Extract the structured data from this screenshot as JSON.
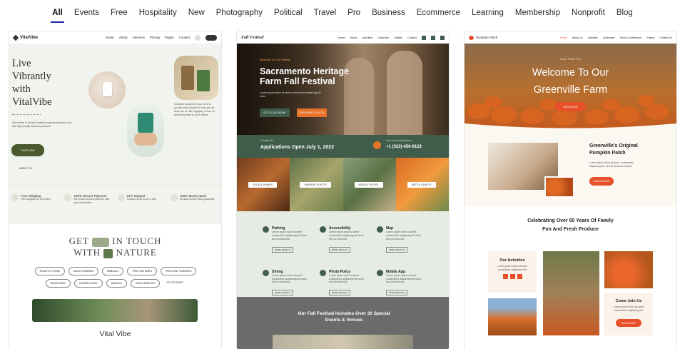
{
  "tabs": [
    "All",
    "Events",
    "Free",
    "Hospitality",
    "New",
    "Photography",
    "Political",
    "Travel",
    "Pro",
    "Business",
    "Ecommerce",
    "Learning",
    "Membership",
    "Nonprofit",
    "Blog"
  ],
  "active_tab": "All",
  "colors": {
    "accent": "#1b2aa8",
    "vital_green": "#4a5a2c",
    "festival_green": "#3f5d4a",
    "farm_orange": "#e8502a"
  },
  "vital": {
    "logo": "VitalVibe",
    "nav": [
      "Home",
      "About",
      "Services",
      "Pricing",
      "Pages",
      "Contact"
    ],
    "headline": [
      "Live",
      "Vibrantly",
      "with",
      "VitalVibe"
    ],
    "intro": "We believe in vibrant, healthy living and empower you with high-quality wellness products.",
    "shop_btn": "SHOP NOW",
    "about_link": "ABOUT US",
    "side_text": "Consider using this if you need to provide more context on why you do what you do. Be engaging. Focus on delivering value to your visitors.",
    "features": [
      {
        "title": "Free Shipping",
        "desc": "Free shipping on all orders"
      },
      {
        "title": "100% Secure Payment",
        "desc": "We ensure secure payment with your information"
      },
      {
        "title": "24/7 Support",
        "desc": "Contact us 24 hours a day"
      },
      {
        "title": "100% Money Back",
        "desc": "30 days money back guarantee"
      }
    ],
    "get_in_touch": [
      "GET",
      "IN TOUCH",
      "WITH",
      "NATURE"
    ],
    "pills": [
      "HEALTHY FOOD",
      "MULTIVITAMINS",
      "OMEGA 3",
      "PROTEIN BARS",
      "PROTEIN POWDERS",
      "SLEEP AIDS",
      "SUPERFOODS",
      "SNACKS",
      "SUPPLEMENTS"
    ],
    "go_shop": "GO TO SHOP",
    "footer_title": "Vital Vibe"
  },
  "fest": {
    "logo": "Fall Festival",
    "nav": [
      "Home",
      "About",
      "Activities",
      "Calendar",
      "Gallery",
      "Contact"
    ],
    "welcome": "Welcome To Our Festival",
    "title": "Sacramento Heritage Farm Fall Festival",
    "lead": "Lorem ipsum dolor sit amet consectetur adipiscing elit dolor.",
    "btn1": "GO TO CALENDAR",
    "btn2": "PURCHASE TICKETS",
    "contact_label": "Contact Us",
    "apps_open": "Applications Open July 1, 2022",
    "call_label": "Call Us Any Questions",
    "phone": "+1 (323)-456-9123",
    "tiles": [
      "FOOD & DRINKS",
      "HAYRIDE TICKETS",
      "KIDS ACTIVITIES",
      "ARTS & CRAFTS"
    ],
    "info": [
      {
        "title": "Parking",
        "btn": "MORE DETAILS"
      },
      {
        "title": "Accessibility",
        "btn": "MORE DETAILS"
      },
      {
        "title": "Map",
        "btn": "MORE DETAILS"
      },
      {
        "title": "Dining",
        "btn": "MORE DETAILS"
      },
      {
        "title": "Photo Policy",
        "btn": "MORE DETAILS"
      },
      {
        "title": "Mobile App",
        "btn": "MORE DETAILS"
      }
    ],
    "info_text": "Lorem ipsum dolor sit amet consectetur adipiscing elit dolor sed do eiusmod.",
    "bottom": "Our Fall Festival Includes Over 30 Special Events & Venues"
  },
  "farm": {
    "logo": "Pumpkin Patch",
    "nav": [
      "Home",
      "About Us",
      "Activities",
      "Schedules",
      "Hours & Admission",
      "Gallery",
      "Contact Us"
    ],
    "eyebrow": "Farm Fresh Fun",
    "headline": "Welcome To Our Greenville Farm",
    "hero_btn": "BOOK NOW",
    "original_title": "Greenville's Original Pumpkin Patch",
    "original_text": "Lorem ipsum dolor sit amet, consectetur adipiscing elit, sed do eiusmod tempor.",
    "learn_btn": "LEARN MORE",
    "celebrate": "Celebrating Over 50 Years Of Family Fun And Fresh Produce",
    "activities_title": "Our Activities",
    "activities_text": "Lorem ipsum dolor sit amet consectetur adipiscing elit.",
    "join_title": "Come Join Us",
    "join_text": "Lorem ipsum dolor sit amet consectetur adipiscing elit.",
    "join_btn": "BOOK NOW"
  }
}
